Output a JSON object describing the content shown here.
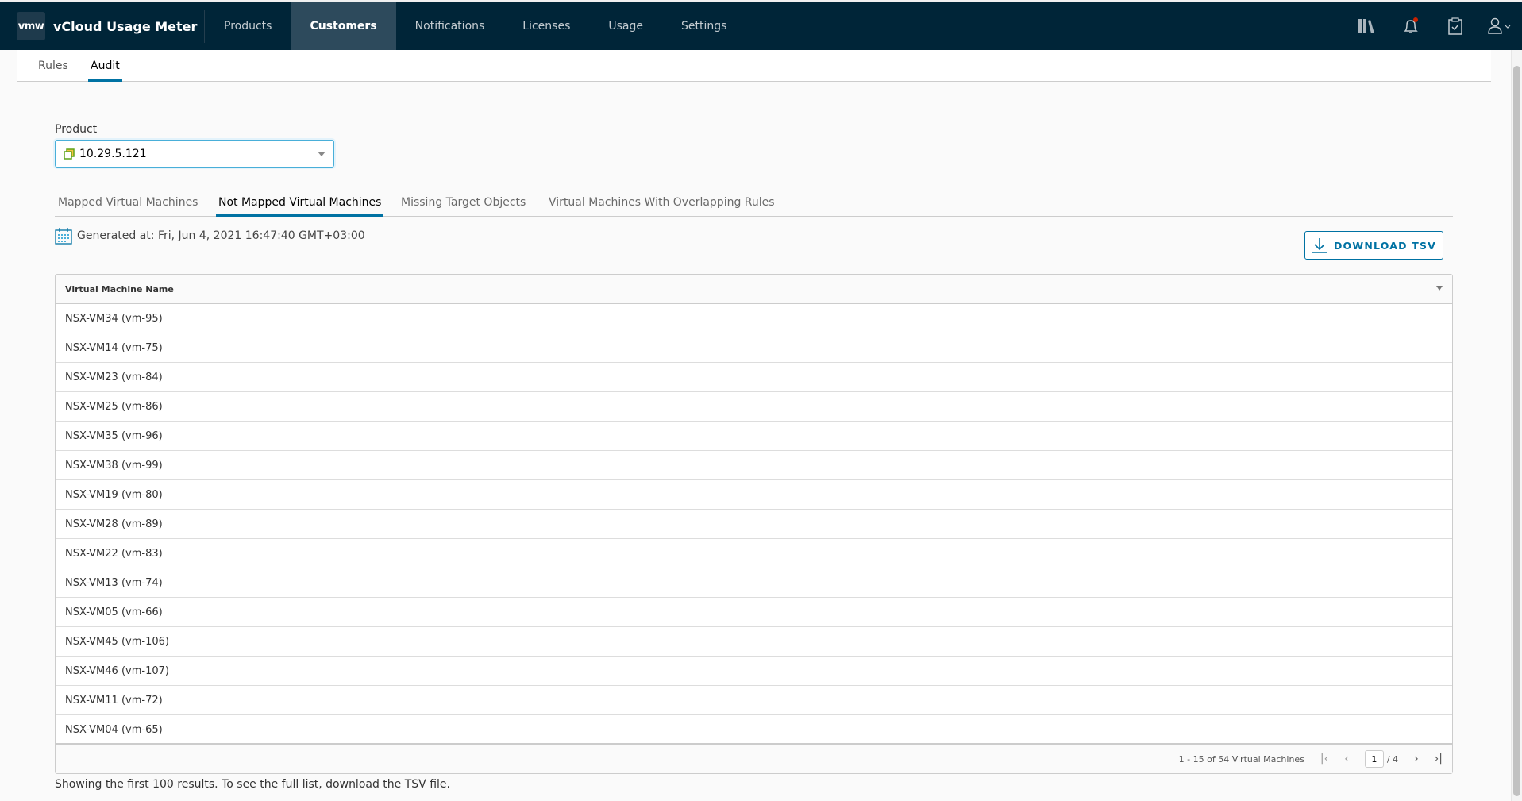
{
  "header": {
    "logo": "vmw",
    "title": "vCloud Usage Meter",
    "nav": [
      "Products",
      "Customers",
      "Notifications",
      "Licenses",
      "Usage",
      "Settings"
    ],
    "active_nav": "Customers",
    "notification_dot_color": "#c92100"
  },
  "subnav": {
    "tabs": [
      "Rules",
      "Audit"
    ],
    "active": "Audit"
  },
  "product": {
    "label": "Product",
    "value": "10.29.5.121"
  },
  "tabs": [
    "Mapped Virtual Machines",
    "Not Mapped Virtual Machines",
    "Missing Target Objects",
    "Virtual Machines With Overlapping Rules"
  ],
  "active_tab": "Not Mapped Virtual Machines",
  "generated": "Generated at: Fri, Jun 4, 2021 16:47:40 GMT+03:00",
  "download_label": "DOWNLOAD TSV",
  "grid": {
    "column": "Virtual Machine Name",
    "rows": [
      "NSX-VM34 (vm-95)",
      "NSX-VM14 (vm-75)",
      "NSX-VM23 (vm-84)",
      "NSX-VM25 (vm-86)",
      "NSX-VM35 (vm-96)",
      "NSX-VM38 (vm-99)",
      "NSX-VM19 (vm-80)",
      "NSX-VM28 (vm-89)",
      "NSX-VM22 (vm-83)",
      "NSX-VM13 (vm-74)",
      "NSX-VM05 (vm-66)",
      "NSX-VM45 (vm-106)",
      "NSX-VM46 (vm-107)",
      "NSX-VM11 (vm-72)",
      "NSX-VM04 (vm-65)"
    ],
    "footer": "1 - 15 of 54 Virtual Machines",
    "page": "1",
    "total_pages": "/ 4"
  },
  "note": "Showing the first 100 results. To see the full list, download the TSV file.",
  "accent": "#0072a3"
}
